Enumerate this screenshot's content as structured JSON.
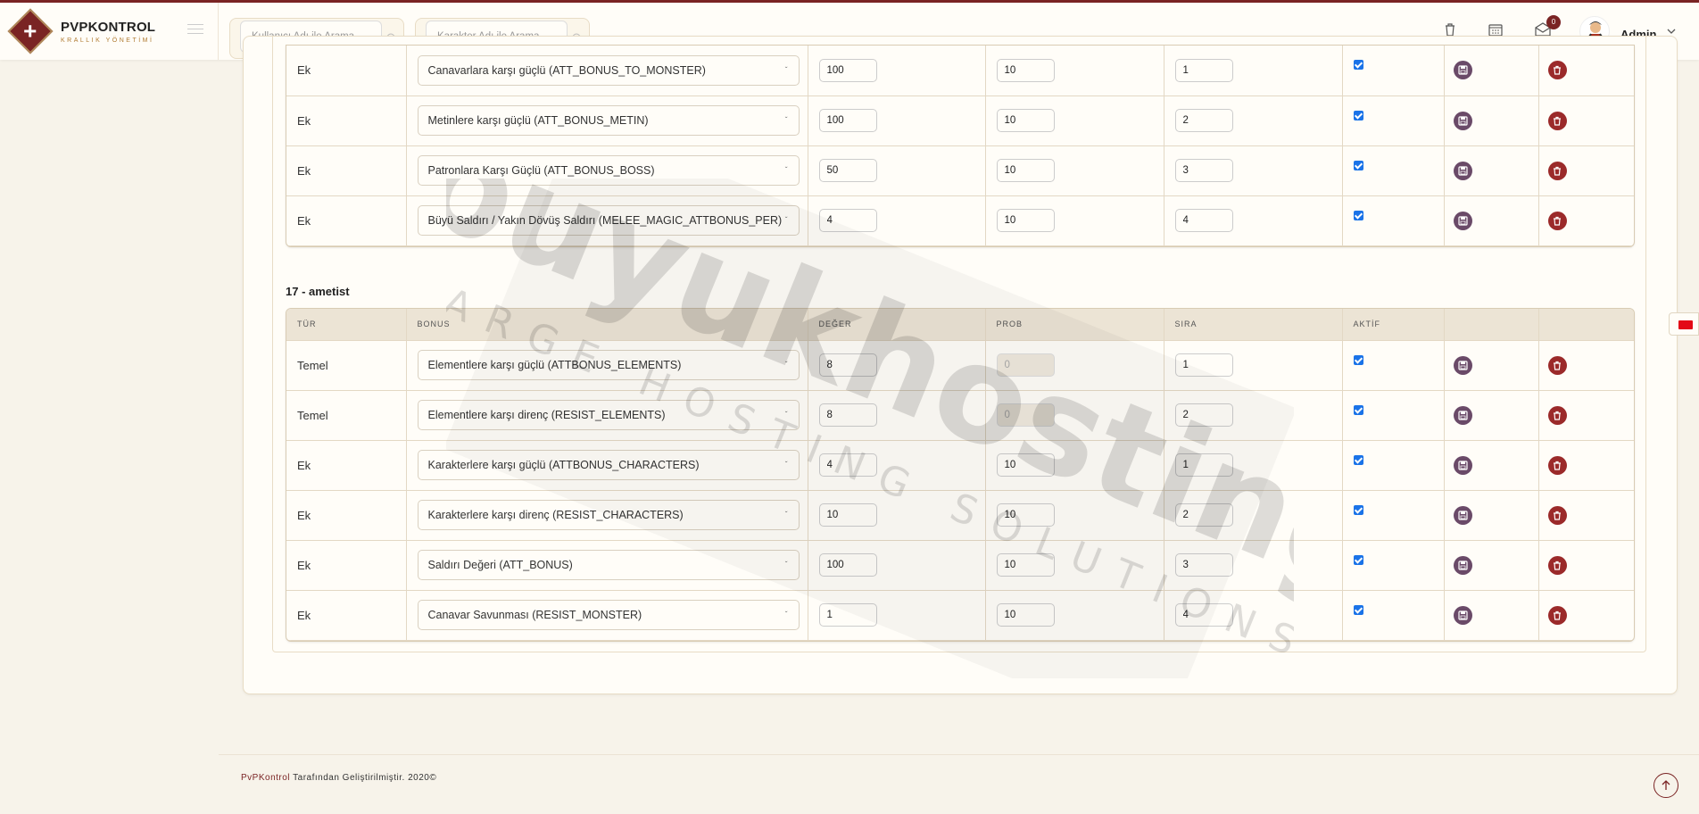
{
  "brand": {
    "name": "PVPKONTROL",
    "subtitle": "KRALLIK YÖNETİMİ"
  },
  "search": {
    "user_placeholder": "Kullanıcı Adı ile Arama",
    "char_placeholder": "Karakter Adı ile Arama"
  },
  "topbar": {
    "mail_badge": "0",
    "admin_name": "Admin"
  },
  "table1": {
    "rows": [
      {
        "tur": "Ek",
        "bonus": "Canavarlara karşı güçlü (ATT_BONUS_TO_MONSTER)",
        "deger": "100",
        "prob": "10",
        "sira": "1"
      },
      {
        "tur": "Ek",
        "bonus": "Metinlere karşı güçlü (ATT_BONUS_METIN)",
        "deger": "100",
        "prob": "10",
        "sira": "2"
      },
      {
        "tur": "Ek",
        "bonus": "Patronlara Karşı Güçlü (ATT_BONUS_BOSS)",
        "deger": "50",
        "prob": "10",
        "sira": "3"
      },
      {
        "tur": "Ek",
        "bonus": "Büyü Saldırı / Yakın Dövüş Saldırı (MELEE_MAGIC_ATTBONUS_PER)",
        "deger": "4",
        "prob": "10",
        "sira": "4"
      }
    ]
  },
  "section2_title": "17 - ametist",
  "table2": {
    "headers": {
      "tur": "TÜR",
      "bonus": "BONUS",
      "deger": "DEĞER",
      "prob": "PROB",
      "sira": "SIRA",
      "aktif": "AKTİF"
    },
    "rows": [
      {
        "tur": "Temel",
        "bonus": "Elementlere karşı güçlü (ATTBONUS_ELEMENTS)",
        "deger": "8",
        "prob": "0",
        "prob_disabled": true,
        "sira": "1"
      },
      {
        "tur": "Temel",
        "bonus": "Elementlere karşı direnç (RESIST_ELEMENTS)",
        "deger": "8",
        "prob": "0",
        "prob_disabled": true,
        "sira": "2"
      },
      {
        "tur": "Ek",
        "bonus": "Karakterlere karşı güçlü (ATTBONUS_CHARACTERS)",
        "deger": "4",
        "prob": "10",
        "sira": "1"
      },
      {
        "tur": "Ek",
        "bonus": "Karakterlere karşı direnç (RESIST_CHARACTERS)",
        "deger": "10",
        "prob": "10",
        "sira": "2"
      },
      {
        "tur": "Ek",
        "bonus": "Saldırı Değeri (ATT_BONUS)",
        "deger": "100",
        "prob": "10",
        "sira": "3"
      },
      {
        "tur": "Ek",
        "bonus": "Canavar Savunması (RESIST_MONSTER)",
        "deger": "1",
        "prob": "10",
        "sira": "4"
      }
    ]
  },
  "watermark": {
    "main": "buyukhosting",
    "sub": "LARGE HOSTING SOLUTIONS"
  },
  "footer": {
    "brand": "PvPKontrol",
    "text": " Tarafından Geliştirilmiştir. 2020©"
  },
  "colors": {
    "accent": "#7a2424",
    "header_bg": "#ece4d5",
    "save": "#6a4a68",
    "delete": "#9b2a2a",
    "check": "#1a73e8"
  }
}
